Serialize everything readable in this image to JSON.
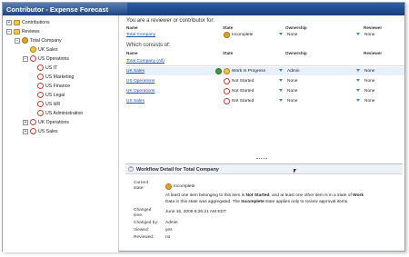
{
  "window": {
    "title": "Contributor - Expense Forecast"
  },
  "tree": [
    {
      "label": "Contributions",
      "icon": "folder-icon"
    },
    {
      "label": "Reviews",
      "icon": "folder-icon"
    },
    {
      "label": "Total Company",
      "icon": "incomplete-status-icon"
    },
    {
      "label": "UK Sales",
      "icon": "in-progress-status-icon"
    },
    {
      "label": "US Operations",
      "icon": "not-started-status-icon"
    },
    {
      "label": "US IT",
      "icon": "not-started-status-icon"
    },
    {
      "label": "US Marketing",
      "icon": "not-started-status-icon"
    },
    {
      "label": "US Finance",
      "icon": "not-started-status-icon"
    },
    {
      "label": "US Legal",
      "icon": "not-started-status-icon"
    },
    {
      "label": "US HR",
      "icon": "not-started-status-icon"
    },
    {
      "label": "US Administration",
      "icon": "not-started-status-icon"
    },
    {
      "label": "UK Operations",
      "icon": "not-started-status-icon"
    },
    {
      "label": "US Sales",
      "icon": "not-started-status-icon"
    }
  ],
  "reviewer_section": {
    "heading": "You are a reviewer or contributor for:",
    "columns": [
      "Name",
      "State",
      "Ownership",
      "Reviewer"
    ],
    "rows": [
      {
        "name": "Total Company",
        "state": "Incomplete",
        "ownership": "None",
        "reviewer": "None"
      }
    ]
  },
  "consists_section": {
    "heading": "Which consists of:",
    "columns": [
      "Name",
      "State",
      "Ownership",
      "Reviewer"
    ],
    "rows": [
      {
        "name": "Total Company (All)",
        "state": "",
        "ownership": "",
        "reviewer": ""
      },
      {
        "name": "UK Sales",
        "state": "Work In Progress",
        "ownership": "Admin",
        "reviewer": "None"
      },
      {
        "name": "US Operations",
        "state": "Not Started",
        "ownership": "None",
        "reviewer": "None"
      },
      {
        "name": "UK Operations",
        "state": "Not Started",
        "ownership": "None",
        "reviewer": "None"
      },
      {
        "name": "US Sales",
        "state": "Not Started",
        "ownership": "None",
        "reviewer": "None"
      }
    ]
  },
  "detail": {
    "title": "Workflow Detail for Total Company",
    "current_state_label": "Current state:",
    "current_state_value": "Incomplete",
    "description_1": "At least one item belonging to this item is ",
    "description_bold_1": "Not Started",
    "description_2": ", and at least one other item is in a state of ",
    "description_bold_2": "Work",
    "description_3": "Data in this state was aggregated. The ",
    "description_bold_3": "Incomplete",
    "description_4": " state applies only to review approval items.",
    "changed_time_label": "Changed time:",
    "changed_time_value": "June 15, 2009 8:26:21 AM EDT",
    "changed_by_label": "Changed by:",
    "changed_by_value": "Admin",
    "viewed_label": "Viewed:",
    "viewed_value": "yes",
    "reviewed_label": "Reviewed:",
    "reviewed_value": "no"
  }
}
